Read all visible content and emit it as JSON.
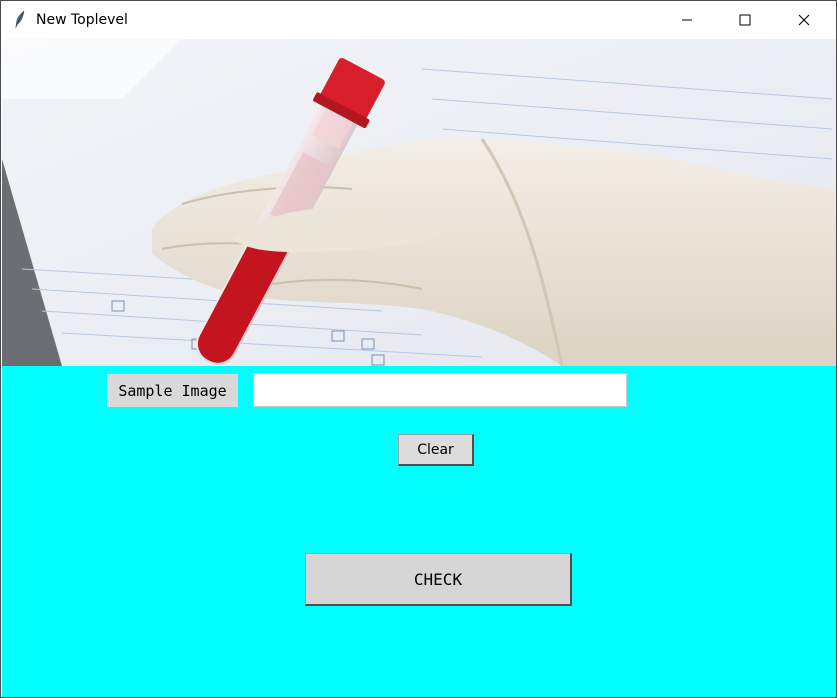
{
  "window": {
    "title": "New Toplevel",
    "icon": "feather-icon",
    "controls": [
      "minimize-icon",
      "maximize-icon",
      "close-icon"
    ]
  },
  "header_image": {
    "description": "gloved hand holding blood sample tube"
  },
  "form": {
    "sample_label": "Sample Image",
    "sample_input_value": "",
    "clear_label": "Clear",
    "check_label": "CHECK"
  },
  "colors": {
    "panel_background": "#00ffff",
    "button_face": "#d9d9d9"
  }
}
